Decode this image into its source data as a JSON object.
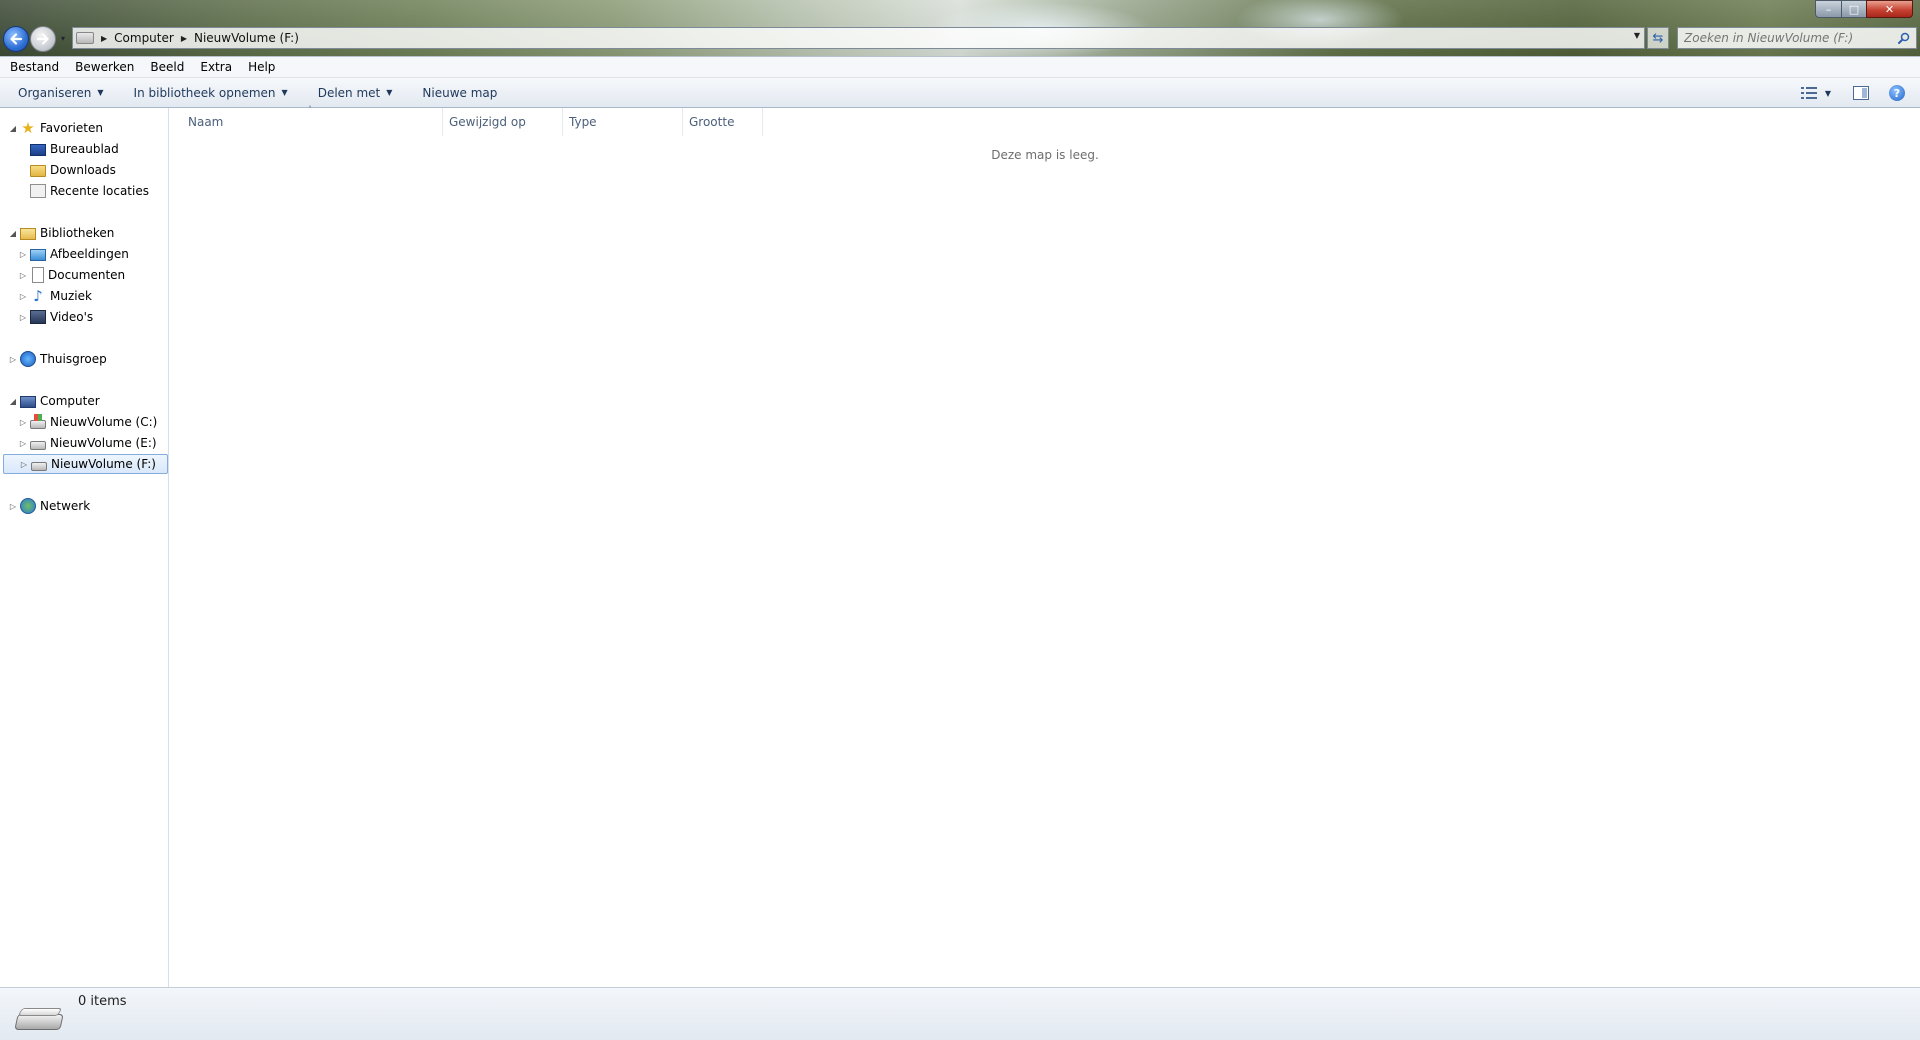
{
  "window": {
    "address": {
      "crumbs": [
        "Computer",
        "NieuwVolume (F:)"
      ]
    },
    "search": {
      "placeholder": "Zoeken in NieuwVolume (F:)"
    }
  },
  "menubar": {
    "items": [
      "Bestand",
      "Bewerken",
      "Beeld",
      "Extra",
      "Help"
    ]
  },
  "commandbar": {
    "organize": "Organiseren",
    "include_library": "In bibliotheek opnemen",
    "share": "Delen met",
    "new_folder": "Nieuwe map"
  },
  "navpane": {
    "favorites": {
      "label": "Favorieten",
      "items": [
        "Bureaublad",
        "Downloads",
        "Recente locaties"
      ]
    },
    "libraries": {
      "label": "Bibliotheken",
      "items": [
        "Afbeeldingen",
        "Documenten",
        "Muziek",
        "Video's"
      ]
    },
    "homegroup": {
      "label": "Thuisgroep"
    },
    "computer": {
      "label": "Computer",
      "items": [
        "NieuwVolume (C:)",
        "NieuwVolume (E:)",
        "NieuwVolume (F:)"
      ]
    },
    "network": {
      "label": "Netwerk"
    }
  },
  "content": {
    "columns": [
      "Naam",
      "Gewijzigd op",
      "Type",
      "Grootte"
    ],
    "empty_message": "Deze map is leeg."
  },
  "statusbar": {
    "item_count": "0 items"
  }
}
